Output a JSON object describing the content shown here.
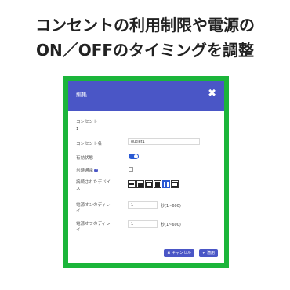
{
  "headline": {
    "line1": "コンセントの利用制限や電源の",
    "line2": "ON／OFFのタイミングを調整"
  },
  "dialog": {
    "title": "編集",
    "close_glyph": "✖",
    "outlet_label": "コンセント",
    "outlet_value": "1",
    "outlet_name_label": "コンセント名",
    "outlet_name_value": "outlet1",
    "enabled_label": "有効状態",
    "enabled": true,
    "usage_limit_label": "常時通電",
    "usage_limit_checked": false,
    "device_label_line1": "接続されたデバイ",
    "device_label_line2": "ス",
    "devices": [
      {
        "icon": "plug-icon",
        "glyph": "▬",
        "active": false
      },
      {
        "icon": "server-icon",
        "glyph": "▤",
        "active": false
      },
      {
        "icon": "printer-icon",
        "glyph": "⎙",
        "active": false
      },
      {
        "icon": "router-icon",
        "glyph": "▣",
        "active": false
      },
      {
        "icon": "download-icon",
        "glyph": "↓",
        "active": true
      },
      {
        "icon": "monitor-icon",
        "glyph": "▭",
        "active": false
      }
    ],
    "on_delay_label_line1": "電源オンのディレ",
    "on_delay_label_line2": "イ",
    "on_delay_value": "1",
    "on_delay_unit": "秒(1~600)",
    "off_delay_label_line1": "電源オフのディレ",
    "off_delay_label_line2": "イ",
    "off_delay_value": "1",
    "off_delay_unit": "秒(1~600)",
    "cancel_label": "✖ キャンセル",
    "apply_label": "✔ 適用"
  },
  "colors": {
    "frame": "#1bb53a",
    "header": "#4a56c6",
    "toggle": "#2a5ad4"
  }
}
